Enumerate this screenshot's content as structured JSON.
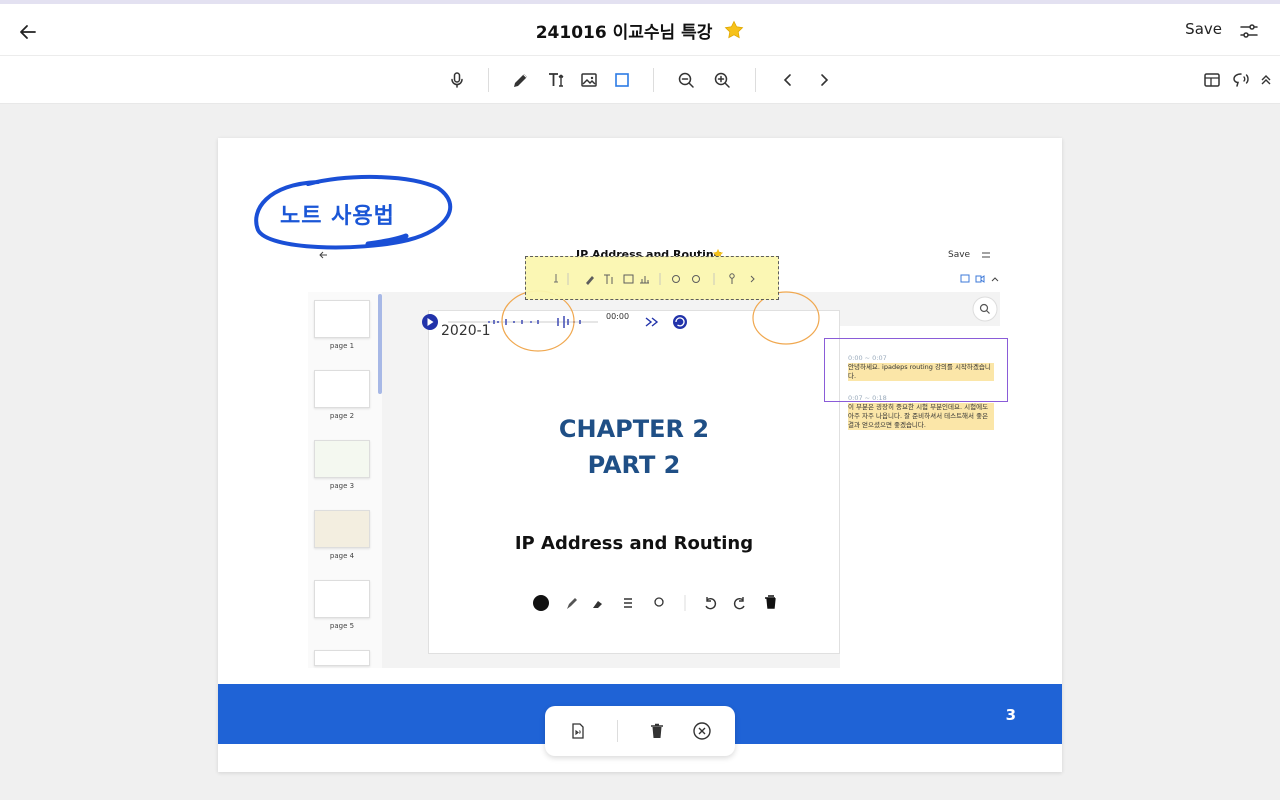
{
  "header": {
    "title": "241016 이교수님 특강",
    "save_label": "Save"
  },
  "icons": {
    "back": "arrow-left-icon",
    "star": "star-icon",
    "settings": "sliders-icon"
  },
  "toolbar": {
    "items": [
      "microphone-icon",
      "pen-icon",
      "text-size-icon",
      "image-icon",
      "rectangle-select-icon",
      "zoom-out-icon",
      "zoom-in-icon",
      "chevron-left-icon",
      "chevron-right-icon",
      "layout-icon",
      "lasso-icon",
      "chevron-up-icon"
    ]
  },
  "colors": {
    "accent": "#1f63d6",
    "highlight": "#fbf7b0",
    "select_blue": "#2c7be5"
  },
  "note": {
    "handwritten_title": "노트 사용법",
    "page_number": "3"
  },
  "embedded": {
    "title": "IP Address and Routing",
    "save_label": "Save",
    "audio_time": "00:00",
    "thumbnails": [
      "page 1",
      "page 2",
      "page 3",
      "page 4",
      "page 5"
    ],
    "slide": {
      "year": "2020-1",
      "chapter_line1": "CHAPTER 2",
      "chapter_line2": "PART 2",
      "subtitle": "IP Address and Routing"
    },
    "transcript": [
      {
        "time": "0:00 ~ 0:07",
        "text": "안녕하세요. ipadeps routing 강의를 시작하겠습니다."
      },
      {
        "time": "0:07 ~ 0:18",
        "text": "이 부분은 굉장히 중요한 시험 부분인데요. 시험에도 아주 자주 나옵니다. 잘 준비하셔서 테스트해서 좋은 결과 얻으셨으면 좋겠습니다."
      }
    ]
  },
  "bottom_actions": [
    "audio-file-icon",
    "trash-icon",
    "close-circle-icon"
  ]
}
